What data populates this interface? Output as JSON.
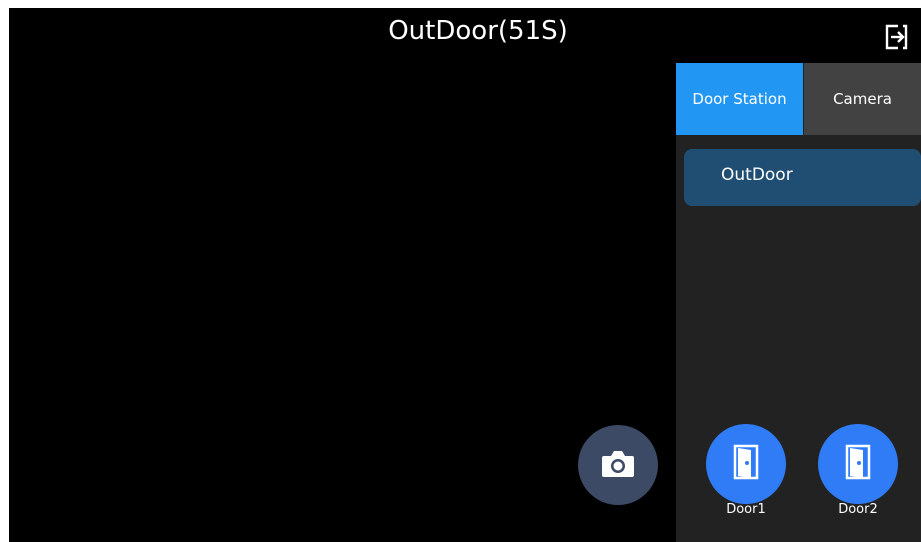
{
  "header": {
    "title": "OutDoor(51S)",
    "exit_icon": "exit-icon"
  },
  "panel": {
    "tabs": [
      {
        "label": "Door Station",
        "active": true
      },
      {
        "label": "Camera",
        "active": false
      }
    ],
    "stations": [
      {
        "label": "OutDoor",
        "selected": true
      }
    ]
  },
  "controls": {
    "snapshot_icon": "camera-icon",
    "doors": [
      {
        "label": "Door1",
        "icon": "door-icon"
      },
      {
        "label": "Door2",
        "icon": "door-icon"
      }
    ]
  },
  "colors": {
    "accent": "#2196f3",
    "door_button": "#2f7cf6",
    "selected_item": "#1f4e72",
    "panel_bg": "#222222",
    "video_bg": "#000000"
  }
}
